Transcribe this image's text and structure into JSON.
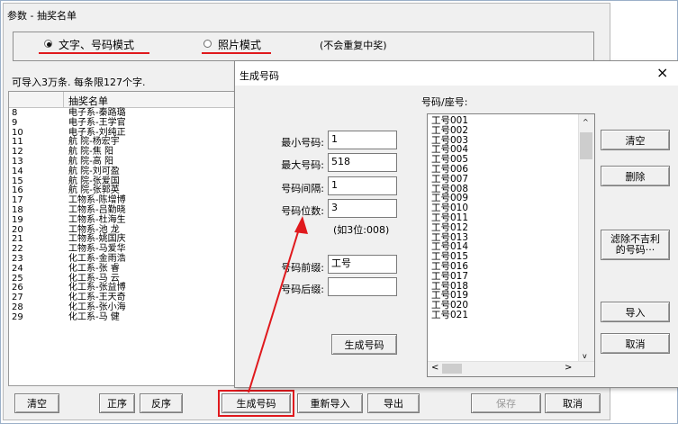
{
  "main": {
    "title": "参数 - 抽奖名单",
    "mode_text": "文字、号码模式",
    "mode_photo": "照片模式",
    "mode_note": "(不会重复中奖)",
    "hint": "可导入3万条. 每条限127个字.",
    "list_header": "抽奖名单",
    "rows": [
      {
        "n": "8",
        "name": "电子系-秦路璐"
      },
      {
        "n": "9",
        "name": "电子系-王学官"
      },
      {
        "n": "10",
        "name": "电子系-刘纯正"
      },
      {
        "n": "11",
        "name": "航 院-杨宏宇"
      },
      {
        "n": "12",
        "name": "航 院-焦 阳"
      },
      {
        "n": "13",
        "name": "航 院-高 阳"
      },
      {
        "n": "14",
        "name": "航 院-刘可盈"
      },
      {
        "n": "15",
        "name": "航 院-张爱国"
      },
      {
        "n": "16",
        "name": "航 院-张郭英"
      },
      {
        "n": "17",
        "name": "工物系-陈增博"
      },
      {
        "n": "18",
        "name": "工物系-吕勤晓"
      },
      {
        "n": "19",
        "name": "工物系-杜海生"
      },
      {
        "n": "20",
        "name": "工物系-池 龙"
      },
      {
        "n": "21",
        "name": "工物系-姚国庆"
      },
      {
        "n": "22",
        "name": "工物系-马爱华"
      },
      {
        "n": "23",
        "name": "化工系-金雨浩"
      },
      {
        "n": "24",
        "name": "化工系-张 睿"
      },
      {
        "n": "25",
        "name": "化工系-马 云"
      },
      {
        "n": "26",
        "name": "化工系-张益博"
      },
      {
        "n": "27",
        "name": "化工系-王天奇"
      },
      {
        "n": "28",
        "name": "化工系-张小海"
      },
      {
        "n": "29",
        "name": "化工系-马 健"
      }
    ],
    "buttons": {
      "clear": "清空",
      "asc": "正序",
      "desc": "反序",
      "generate": "生成号码",
      "reimport": "重新导入",
      "export": "导出",
      "save": "保存",
      "cancel": "取消"
    }
  },
  "dialog": {
    "title": "生成号码",
    "close": "×",
    "labels": {
      "min": "最小号码:",
      "max": "最大号码:",
      "step": "号码间隔:",
      "digits": "号码位数:",
      "prefix": "号码前缀:",
      "suffix": "号码后缀:"
    },
    "values": {
      "min": "1",
      "max": "518",
      "step": "1",
      "digits": "3",
      "prefix": "工号",
      "suffix": ""
    },
    "digits_hint": "(如3位:008)",
    "generate_button": "生成号码",
    "list_label": "号码/座号:",
    "codes": [
      "工号001",
      "工号002",
      "工号003",
      "工号004",
      "工号005",
      "工号006",
      "工号007",
      "工号008",
      "工号009",
      "工号010",
      "工号011",
      "工号012",
      "工号013",
      "工号014",
      "工号015",
      "工号016",
      "工号017",
      "工号018",
      "工号019",
      "工号020",
      "工号021"
    ],
    "side_buttons": {
      "clear": "清空",
      "delete": "删除",
      "filter_line1": "滤除不吉利",
      "filter_line2": "的号码···",
      "import": "导入",
      "cancel": "取消"
    }
  },
  "colors": {
    "annotation_red": "#e0191d"
  }
}
